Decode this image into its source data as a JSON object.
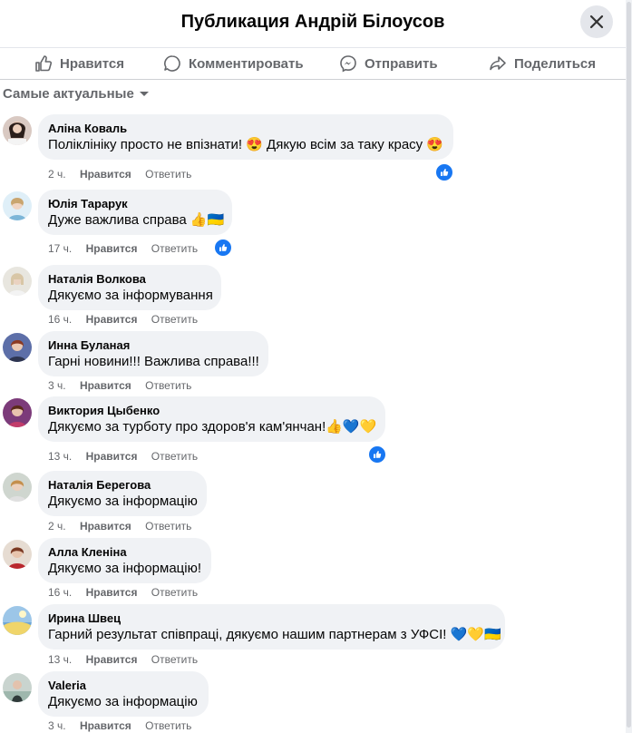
{
  "header": {
    "title": "Публикация Андрій Білоусов"
  },
  "actions": {
    "like": "Нравится",
    "comment": "Комментировать",
    "send": "Отправить",
    "share": "Поделиться"
  },
  "sort": {
    "label": "Самые актуальные"
  },
  "comments": [
    {
      "author": "Аліна Коваль",
      "text": "Поліклініку просто не впізнати! 😍 Дякую всім за таку красу 😍",
      "time": "2 ч.",
      "like": "Нравится",
      "reply": "Ответить",
      "reaction": "like"
    },
    {
      "author": "Юлія Тарарук",
      "text": "Дуже важлива справа 👍🇺🇦",
      "time": "17 ч.",
      "like": "Нравится",
      "reply": "Ответить",
      "reaction": "like"
    },
    {
      "author": "Наталія Волкова",
      "text": "Дякуємо за інформування",
      "time": "16 ч.",
      "like": "Нравится",
      "reply": "Ответить"
    },
    {
      "author": "Инна Буланая",
      "text": "Гарні новини!!! Важлива справа!!!",
      "time": "3 ч.",
      "like": "Нравится",
      "reply": "Ответить"
    },
    {
      "author": "Виктория Цыбенко",
      "text": "Дякуємо за турботу про здоров'я кам'янчан!👍💙💛",
      "time": "13 ч.",
      "like": "Нравится",
      "reply": "Ответить",
      "reaction": "like"
    },
    {
      "author": "Наталія Берегова",
      "text": "Дякуємо за інформацію",
      "time": "2 ч.",
      "like": "Нравится",
      "reply": "Ответить"
    },
    {
      "author": "Алла Кленіна",
      "text": "Дякуємо за інформацію!",
      "time": "16 ч.",
      "like": "Нравится",
      "reply": "Ответить"
    },
    {
      "author": "Ирина Швец",
      "text": "Гарний результат співпраці, дякуємо нашим партнерам з УФСІ! 💙💛🇺🇦",
      "time": "13 ч.",
      "like": "Нравится",
      "reply": "Ответить"
    },
    {
      "author": "Valeria",
      "text": "Дякуємо за інформацію",
      "time": "3 ч.",
      "like": "Нравится",
      "reply": "Ответить"
    }
  ],
  "colors": {
    "accent": "#1877f2",
    "bubble": "#f0f2f5",
    "secondary_text": "#65676b"
  }
}
